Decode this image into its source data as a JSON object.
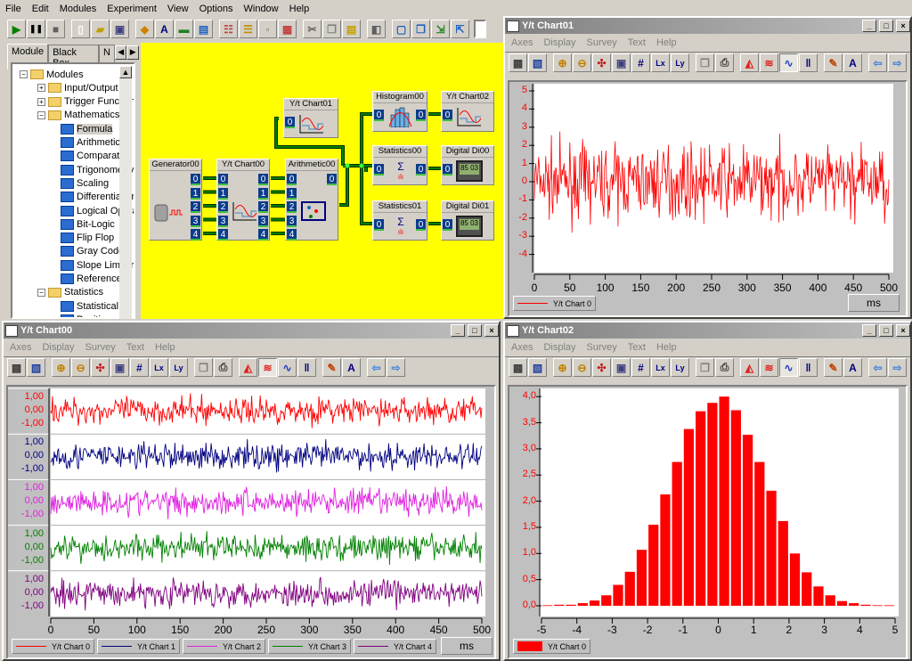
{
  "menu": [
    "File",
    "Edit",
    "Modules",
    "Experiment",
    "View",
    "Options",
    "Window",
    "Help"
  ],
  "toolbar": [
    "play-icon",
    "pause-icon",
    "stop-icon",
    "|",
    "new-file-icon",
    "open-icon",
    "save-icon",
    "|",
    "module-icon",
    "ad-converter-icon",
    "card-icon",
    "list-window-icon",
    "|",
    "tree-icon",
    "hierarchy-icon",
    "blocks-icon",
    "layout-icon",
    "|",
    "cut-icon",
    "copy-icon",
    "paste-icon",
    "|",
    "box-3d-icon",
    "|",
    "window-icon",
    "windows-cascade-icon",
    "export-icon",
    "import-icon"
  ],
  "left_panel": {
    "tabs": [
      "Module",
      "Black Box",
      "N"
    ],
    "tree": [
      {
        "label": "Modules",
        "level": 0,
        "type": "folder",
        "expander": "−"
      },
      {
        "label": "Input/Output",
        "level": 1,
        "type": "folder",
        "expander": "+"
      },
      {
        "label": "Trigger Functions",
        "level": 1,
        "type": "folder",
        "expander": "+"
      },
      {
        "label": "Mathematics",
        "level": 1,
        "type": "folder",
        "expander": "−"
      },
      {
        "label": "Formula",
        "level": 2,
        "type": "module",
        "selected": true
      },
      {
        "label": "Arithmetic",
        "level": 2,
        "type": "module"
      },
      {
        "label": "Comparator",
        "level": 2,
        "type": "module"
      },
      {
        "label": "Trigonometry",
        "level": 2,
        "type": "module"
      },
      {
        "label": "Scaling",
        "level": 2,
        "type": "module"
      },
      {
        "label": "Differentiation",
        "level": 2,
        "type": "module"
      },
      {
        "label": "Logical Operations",
        "level": 2,
        "type": "module"
      },
      {
        "label": "Bit-Logic",
        "level": 2,
        "type": "module"
      },
      {
        "label": "Flip Flop",
        "level": 2,
        "type": "module"
      },
      {
        "label": "Gray Code",
        "level": 2,
        "type": "module"
      },
      {
        "label": "Slope Limiter",
        "level": 2,
        "type": "module"
      },
      {
        "label": "Reference",
        "level": 2,
        "type": "module"
      },
      {
        "label": "Statistics",
        "level": 1,
        "type": "folder",
        "expander": "−"
      },
      {
        "label": "Statistical",
        "level": 2,
        "type": "module"
      },
      {
        "label": "Position",
        "level": 2,
        "type": "module"
      }
    ]
  },
  "workspace": {
    "background": "#ffff00",
    "wire_color": "#008000",
    "blocks": [
      {
        "id": "gen",
        "title": "Generator00",
        "inputs": [],
        "outputs": [
          "0",
          "1",
          "2",
          "3",
          "4"
        ]
      },
      {
        "id": "yt0",
        "title": "Y/t Chart00",
        "inputs": [
          "0",
          "1",
          "2",
          "3",
          "4"
        ],
        "outputs": [
          "0",
          "1",
          "2",
          "3",
          "4"
        ]
      },
      {
        "id": "ari",
        "title": "Arithmetic00",
        "inputs": [
          "0",
          "1",
          "2",
          "3",
          "4"
        ],
        "outputs": [
          "0"
        ]
      },
      {
        "id": "yt1",
        "title": "Y/t Chart01",
        "inputs": [
          "0"
        ],
        "outputs": []
      },
      {
        "id": "his",
        "title": "Histogram00",
        "inputs": [
          "0"
        ],
        "outputs": [
          "0"
        ]
      },
      {
        "id": "yt2",
        "title": "Y/t Chart02",
        "inputs": [
          "0"
        ],
        "outputs": []
      },
      {
        "id": "st0",
        "title": "Statistics00",
        "inputs": [
          "0"
        ],
        "outputs": [
          "0"
        ]
      },
      {
        "id": "dd0",
        "title": "Digital Di00",
        "inputs": [
          "0"
        ],
        "outputs": []
      },
      {
        "id": "st1",
        "title": "Statistics01",
        "inputs": [
          "0"
        ],
        "outputs": [
          "0"
        ]
      },
      {
        "id": "dd1",
        "title": "Digital Di01",
        "inputs": [
          "0"
        ],
        "outputs": []
      }
    ]
  },
  "chart_window": {
    "menu": [
      "Axes",
      "Display",
      "Survey",
      "Text",
      "Help"
    ],
    "toolbar": [
      "chart-settings-icon",
      "chart-clear-icon",
      "|",
      "zoom-in-icon",
      "zoom-out-icon",
      "cursor-icon",
      "save-icon",
      "grid-icon",
      "x-axis-icon",
      "y-axis-icon",
      "|",
      "copy-icon",
      "print-icon",
      "|",
      "area-icon",
      "multi-lane-icon",
      "line-icon",
      "bars-icon",
      "|",
      "brush-icon",
      "font-icon",
      "|",
      "back-icon",
      "forward-icon"
    ],
    "win_buttons": [
      "_",
      "□",
      "×"
    ]
  },
  "chart_data": [
    {
      "window": "Y/t Chart01",
      "type": "line",
      "x_ticks": [
        "0",
        "50",
        "100",
        "150",
        "200",
        "250",
        "300",
        "350",
        "400",
        "450",
        "500"
      ],
      "xlim": [
        0,
        500
      ],
      "y_ticks": [
        "5",
        "4",
        "3",
        "2",
        "1",
        "0",
        "-1",
        "-2",
        "-3",
        "-4"
      ],
      "ylim": [
        -4.2,
        5.3
      ],
      "unit": "ms",
      "series": [
        {
          "name": "Y/t Chart 0",
          "color": "#ff0000",
          "signal": "noise",
          "std": 1.2
        }
      ]
    },
    {
      "window": "Y/t Chart00",
      "type": "line",
      "x_ticks": [
        "0",
        "50",
        "100",
        "150",
        "200",
        "250",
        "300",
        "350",
        "400",
        "450",
        "500"
      ],
      "xlim": [
        0,
        500
      ],
      "lane_ticks": [
        "1,00",
        "0,00",
        "-1,00"
      ],
      "ylim": [
        -1.5,
        1.5
      ],
      "unit": "ms",
      "series": [
        {
          "name": "Y/t Chart 0",
          "color": "#ff0000"
        },
        {
          "name": "Y/t Chart 1",
          "color": "#000080"
        },
        {
          "name": "Y/t Chart 2",
          "color": "#e020e0"
        },
        {
          "name": "Y/t Chart 3",
          "color": "#008000"
        },
        {
          "name": "Y/t Chart 4",
          "color": "#800080"
        }
      ]
    },
    {
      "window": "Y/t Chart02",
      "type": "bar",
      "x_ticks": [
        "-5",
        "-4",
        "-3",
        "-2",
        "-1",
        "0",
        "1",
        "2",
        "3",
        "4",
        "5"
      ],
      "xlim": [
        -5,
        5
      ],
      "y_ticks": [
        "4,0",
        "3,5",
        "3,0",
        "2,5",
        "2,0",
        "1,5",
        "1,0",
        "0,5",
        "0,0"
      ],
      "ylim": [
        0,
        4
      ],
      "bin_width": 0.333,
      "values": [
        0.01,
        0.02,
        0.02,
        0.05,
        0.1,
        0.2,
        0.4,
        0.65,
        1.07,
        1.55,
        2.13,
        2.75,
        3.38,
        3.72,
        3.88,
        4.0,
        3.74,
        3.27,
        2.75,
        2.2,
        1.62,
        1.0,
        0.64,
        0.37,
        0.2,
        0.09,
        0.05,
        0.02,
        0.01,
        0.01
      ],
      "series": [
        {
          "name": "Y/t Chart 0",
          "color": "#ff0000"
        }
      ]
    }
  ]
}
